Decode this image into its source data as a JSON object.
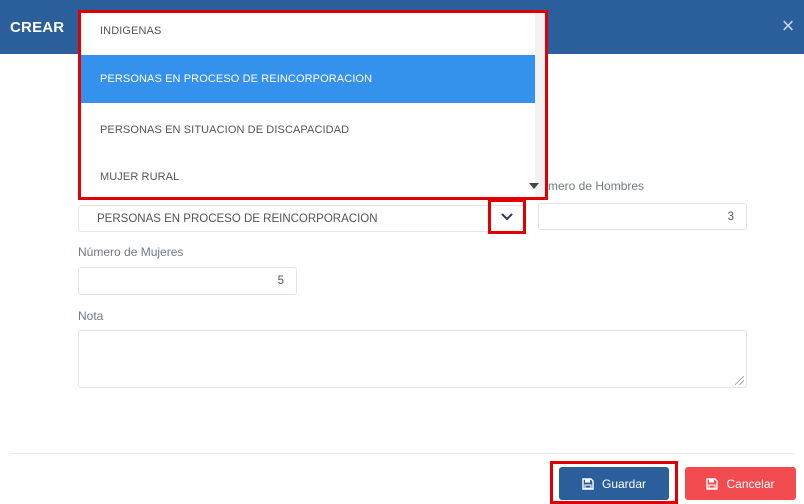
{
  "header": {
    "title": "CREAR",
    "close_glyph": "×"
  },
  "dropdown": {
    "options": [
      {
        "label": "INDIGENAS",
        "selected": false
      },
      {
        "label": "PERSONAS EN PROCESO DE REINCORPORACION",
        "selected": true
      },
      {
        "label": "PERSONAS EN SITUACION DE DISCAPACIDAD",
        "selected": false
      },
      {
        "label": "MUJER RURAL",
        "selected": false
      }
    ]
  },
  "form": {
    "population_select": {
      "value": "PERSONAS EN PROCESO DE REINCORPORACION",
      "arrow_icon": "chevron-down-icon"
    },
    "men": {
      "label": "mero de Hombres",
      "value": "3"
    },
    "women": {
      "label": "Número de Mujeres",
      "value": "5"
    },
    "note": {
      "label": "Nota",
      "value": ""
    }
  },
  "footer": {
    "save_label": "Guardar",
    "cancel_label": "Cancelar",
    "save_icon": "save-icon",
    "cancel_icon": "save-icon"
  },
  "colors": {
    "header": "#2b5f9c",
    "selected_option": "#3592ec",
    "highlight": "#e00000",
    "save_button": "#2b5f9c",
    "cancel_button": "#f24b4f"
  }
}
